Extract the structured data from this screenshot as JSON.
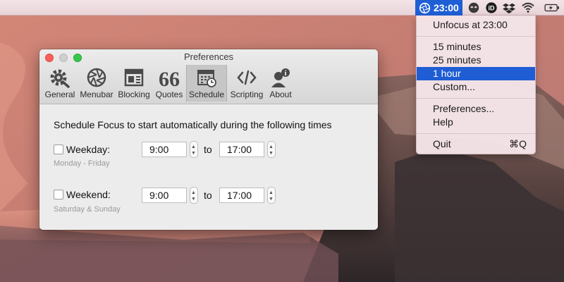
{
  "menubar": {
    "focus_time": "23:00",
    "icons": [
      "focus-icon",
      "alien-icon",
      "id-icon",
      "dropbox-icon",
      "wifi-icon",
      "battery-icon"
    ]
  },
  "menu": {
    "unfocus": "Unfocus at 23:00",
    "durations": [
      "15 minutes",
      "25 minutes",
      "1 hour",
      "Custom..."
    ],
    "selected": "1 hour",
    "preferences": "Preferences...",
    "help": "Help",
    "quit": "Quit",
    "quit_shortcut": "⌘Q"
  },
  "window": {
    "title": "Preferences",
    "tabs": [
      {
        "label": "General",
        "icon": "gear-icon"
      },
      {
        "label": "Menubar",
        "icon": "aperture-icon"
      },
      {
        "label": "Blocking",
        "icon": "browser-window-icon"
      },
      {
        "label": "Quotes",
        "icon": "quote-icon"
      },
      {
        "label": "Schedule",
        "icon": "calendar-icon"
      },
      {
        "label": "Scripting",
        "icon": "code-icon"
      },
      {
        "label": "About",
        "icon": "person-info-icon"
      }
    ],
    "selected_tab": "Schedule",
    "heading": "Schedule Focus to start automatically during the following times",
    "weekday": {
      "label": "Weekday:",
      "sub": "Monday - Friday",
      "from": "9:00",
      "to": "17:00",
      "checked": false
    },
    "weekend": {
      "label": "Weekend:",
      "sub": "Saturday & Sunday",
      "from": "9:00",
      "to": "17:00",
      "checked": false
    },
    "to_label": "to"
  },
  "colors": {
    "highlight": "#1e5dd4",
    "close": "#fc5f57",
    "maximize": "#35c84a"
  }
}
